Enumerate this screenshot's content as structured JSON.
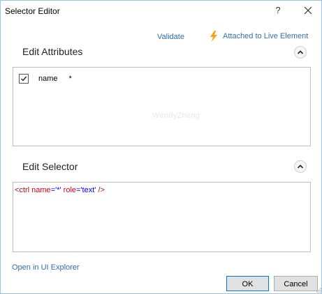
{
  "window": {
    "title": "Selector Editor",
    "help_label": "?",
    "close_icon": "close-icon"
  },
  "toolbar": {
    "validate_label": "Validate",
    "attached_label": "Attached to Live Element",
    "attached_icon": "lightning-bolt-icon",
    "attached_icon_color": "#f5a31a"
  },
  "attributes": {
    "title": "Edit Attributes",
    "rows": [
      {
        "checked": true,
        "name": "name",
        "value": "*"
      }
    ],
    "watermark": "WendyZheng"
  },
  "selector": {
    "title": "Edit Selector",
    "code": {
      "open": "<ctrl ",
      "attr1": "name",
      "eq1": "=",
      "val1": "'*'",
      "space": " ",
      "attr2": "role",
      "eq2": "=",
      "val2": "'text'",
      "close": " />"
    }
  },
  "footer": {
    "open_explorer_label": "Open in UI Explorer",
    "ok_label": "OK",
    "cancel_label": "Cancel"
  },
  "colors": {
    "link": "#2f6fb5",
    "selector_tag": "#a31515",
    "selector_attr": "#e0001a",
    "selector_value": "#0000ff",
    "window_border": "#9dc3e6"
  }
}
